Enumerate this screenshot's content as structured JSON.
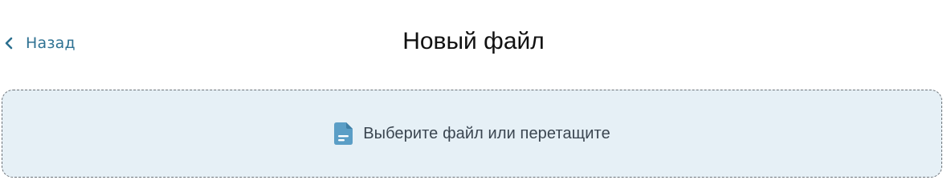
{
  "header": {
    "back_label": "Назад",
    "title": "Новый файл"
  },
  "dropzone": {
    "label": "Выберите файл или перетащите",
    "icon": "file-text-icon"
  },
  "colors": {
    "link": "#2f7293",
    "dropzone_bg": "#e6f0f6",
    "dropzone_border": "#6c7278",
    "icon": "#5b9ec6"
  }
}
